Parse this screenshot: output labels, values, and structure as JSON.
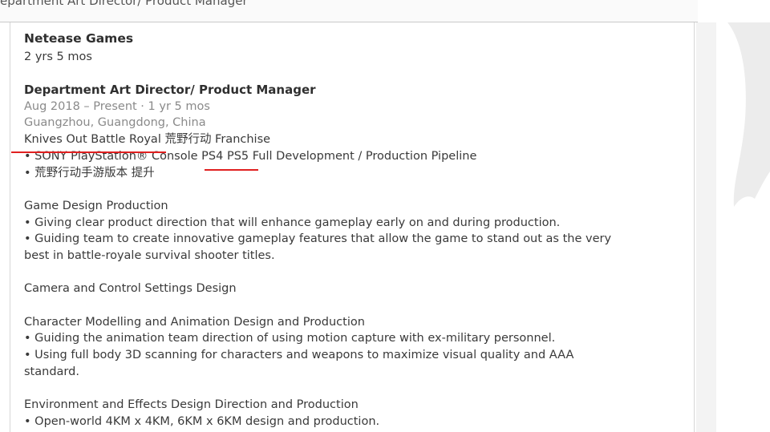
{
  "page_header": {
    "title": "epartment Art Director/ Product Manager"
  },
  "experience": {
    "company": "Netease Games",
    "tenure": "2 yrs 5 mos",
    "role_title": "Department Art Director/ Product Manager",
    "dates": "Aug 2018 – Present · 1 yr 5 mos",
    "location": "Guangzhou, Guangdong, China",
    "franchise_line": {
      "title": "Knives Out Battle Royal",
      "suffix": " 荒野行动 Franchise"
    },
    "bullet_sony": {
      "prefix": "• SONY PlayStation® Console ",
      "platforms": "PS4 PS5",
      "suffix": " Full Development / Production Pipeline"
    },
    "bullet_mobile": "• 荒野行动手游版本 提升",
    "sections": [
      {
        "heading": "Game Design Production",
        "lines": [
          "• Giving clear product direction that will enhance gameplay early on and during production.",
          "• Guiding team to create innovative gameplay features that allow the game to stand out as the very",
          "best in battle-royale survival shooter titles."
        ]
      },
      {
        "heading": "Camera and Control Settings Design",
        "lines": []
      },
      {
        "heading": "Character Modelling and Animation Design and Production",
        "lines": [
          "• Guiding the animation team direction of using motion capture with ex-military personnel.",
          "• Using full body 3D scanning for characters and weapons to maximize visual quality and AAA",
          "standard."
        ]
      },
      {
        "heading": "Environment and Effects Design Direction and Production",
        "lines": [
          "• Open-world 4KM x 4KM, 6KM x 6KM design and production."
        ]
      }
    ]
  },
  "colors": {
    "annotation_red": "#e02020",
    "muted_text": "#8a8a8a"
  }
}
